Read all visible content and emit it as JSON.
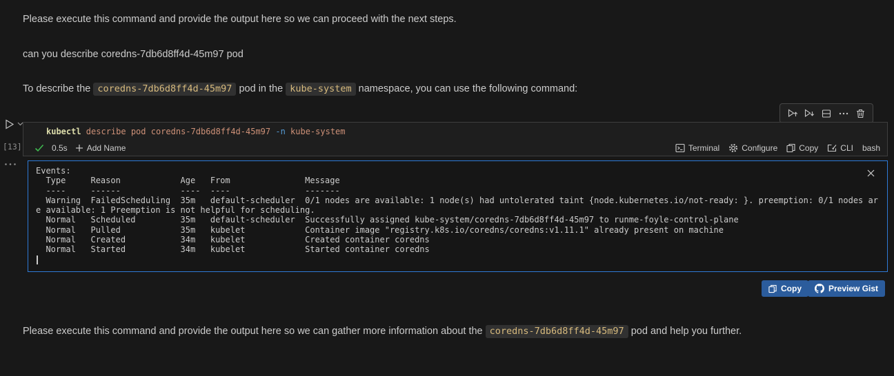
{
  "colors": {
    "page_bg": "#181818",
    "cell_bg": "#1e1e1e",
    "terminal_bg": "#161616",
    "focus_border_blue": "#2e7bd8",
    "button_blue": "#2b5c9c",
    "success_green": "#3fb950",
    "inline_code_text": "#d7ba7d",
    "syntax_command": "#dcdcaa",
    "syntax_argument": "#ce9178",
    "syntax_flag": "#569cd6"
  },
  "paragraphs": {
    "p1": "Please execute this command and provide the output here so we can proceed with the next steps.",
    "p2": "can you describe coredns-7db6d8ff4d-45m97 pod",
    "p3_prefix": "To describe the ",
    "p3_code_pod": "coredns-7db6d8ff4d-45m97",
    "p3_mid": " pod in the ",
    "p3_code_ns": "kube-system",
    "p3_suffix": " namespace, you can use the following command:",
    "p4_prefix": "Please execute this command and provide the output here so we can gather more information about the ",
    "p4_code_pod": "coredns-7db6d8ff4d-45m97",
    "p4_suffix": " pod and help you further."
  },
  "cell": {
    "execution_count": "[13]",
    "command": {
      "program": "kubectl",
      "args_a": " describe pod coredns-7db6d8ff4d-45m97 ",
      "flag": "-n",
      "args_b": " kube-system"
    },
    "status": {
      "duration": "0.5s",
      "add_name_label": "Add Name",
      "terminal_label": "Terminal",
      "configure_label": "Configure",
      "copy_label": "Copy",
      "cli_label": "CLI",
      "shell_label": "bash"
    }
  },
  "output": {
    "lines": [
      "Events:",
      "  Type     Reason            Age   From               Message",
      "  ----     ------            ----  ----               -------",
      "  Warning  FailedScheduling  35m   default-scheduler  0/1 nodes are available: 1 node(s) had untolerated taint {node.kubernetes.io/not-ready: }. preemption: 0/1 nodes ar",
      "e available: 1 Preemption is not helpful for scheduling.",
      "  Normal   Scheduled         35m   default-scheduler  Successfully assigned kube-system/coredns-7db6d8ff4d-45m97 to runme-foyle-control-plane",
      "  Normal   Pulled            35m   kubelet            Container image \"registry.k8s.io/coredns/coredns:v1.11.1\" already present on machine",
      "  Normal   Created           34m   kubelet            Created container coredns",
      "  Normal   Started           34m   kubelet            Started container coredns"
    ]
  },
  "actions": {
    "copy_label": "Copy",
    "preview_gist_label": "Preview Gist"
  }
}
